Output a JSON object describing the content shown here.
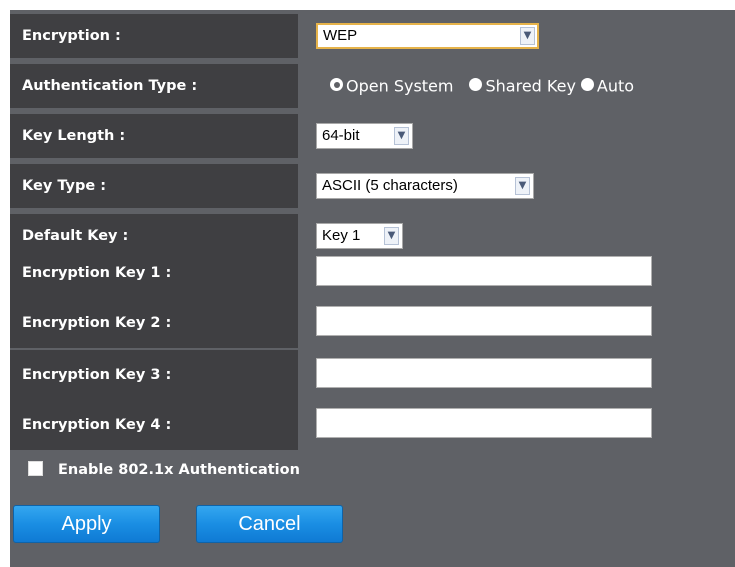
{
  "form": {
    "encryption": {
      "label": "Encryption :",
      "value": "WEP",
      "arrow_icon": "chevron-down-icon"
    },
    "authentication_type": {
      "label": "Authentication Type :",
      "options": [
        {
          "label": "Open System",
          "selected": true
        },
        {
          "label": "Shared Key",
          "selected": false
        },
        {
          "label": "Auto",
          "selected": false
        }
      ]
    },
    "key_length": {
      "label": "Key Length :",
      "value": "64-bit"
    },
    "key_type": {
      "label": "Key Type :",
      "value": "ASCII (5 characters)"
    },
    "default_key": {
      "label": "Default Key :",
      "value": "Key 1"
    },
    "encryption_keys": [
      {
        "label": "Encryption Key 1 :",
        "value": ""
      },
      {
        "label": "Encryption Key 2 :",
        "value": ""
      },
      {
        "label": "Encryption Key 3 :",
        "value": ""
      },
      {
        "label": "Encryption Key 4 :",
        "value": ""
      }
    ],
    "enable_8021x": {
      "label": "Enable 802.1x Authentication",
      "checked": false
    }
  },
  "buttons": {
    "apply_label": "Apply",
    "cancel_label": "Cancel"
  },
  "colors": {
    "panel_bg": "#5f6166",
    "label_bg": "#3f3f42",
    "button_blue": "#1a8ee3",
    "focus_border": "#e6b34a"
  }
}
